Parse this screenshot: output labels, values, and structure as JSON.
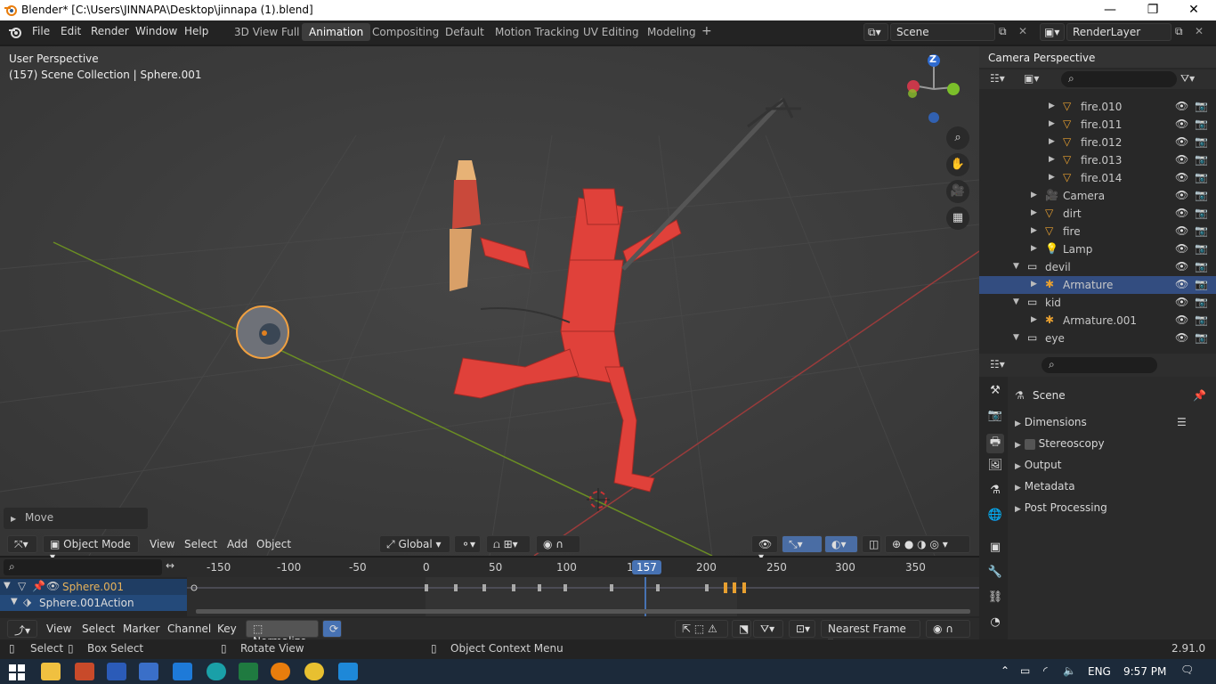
{
  "titlebar": {
    "title": "Blender* [C:\\Users\\JINNAPA\\Desktop\\jinnapa (1).blend]",
    "min": "—",
    "max": "❐",
    "close": "✕"
  },
  "menu": [
    "File",
    "Edit",
    "Render",
    "Window",
    "Help"
  ],
  "workspaces": [
    "3D View Full",
    "Animation",
    "Compositing",
    "Default",
    "Motion Tracking",
    "UV Editing",
    "Modeling"
  ],
  "workspace_add": "+",
  "scene_field": "Scene",
  "renderlayer_field": "RenderLayer",
  "viewport": {
    "perspective": "User Perspective",
    "collection": "(157) Scene Collection | Sphere.001",
    "gizmo_z": "Z",
    "operator": "Move"
  },
  "viewport_header": {
    "mode": "Object Mode",
    "menus": [
      "View",
      "Select",
      "Add",
      "Object"
    ],
    "transform": "Global"
  },
  "outliner": {
    "header": "Camera Perspective",
    "rows": [
      {
        "label": "fire.010",
        "indent": 3,
        "icon": "mesh-icon"
      },
      {
        "label": "fire.011",
        "indent": 3,
        "icon": "mesh-icon"
      },
      {
        "label": "fire.012",
        "indent": 3,
        "icon": "mesh-icon"
      },
      {
        "label": "fire.013",
        "indent": 3,
        "icon": "mesh-icon"
      },
      {
        "label": "fire.014",
        "indent": 3,
        "icon": "mesh-icon"
      },
      {
        "label": "Camera",
        "indent": 2,
        "icon": "camera-icon"
      },
      {
        "label": "dirt",
        "indent": 2,
        "icon": "mesh-icon"
      },
      {
        "label": "fire",
        "indent": 2,
        "icon": "mesh-icon"
      },
      {
        "label": "Lamp",
        "indent": 2,
        "icon": "lamp-icon"
      },
      {
        "label": "devil",
        "indent": 1,
        "icon": "collection-icon"
      },
      {
        "label": "Armature",
        "indent": 2,
        "icon": "armature-icon",
        "selected": true
      },
      {
        "label": "kid",
        "indent": 1,
        "icon": "collection-icon"
      },
      {
        "label": "Armature.001",
        "indent": 2,
        "icon": "armature-icon"
      },
      {
        "label": "eye",
        "indent": 1,
        "icon": "collection-icon"
      }
    ]
  },
  "properties": {
    "context": "Scene",
    "panels": [
      "Dimensions",
      "Stereoscopy",
      "Output",
      "Metadata",
      "Post Processing"
    ]
  },
  "timeline": {
    "ticks": [
      "-150",
      "-100",
      "-50",
      "0",
      "50",
      "100",
      "1",
      "157",
      "200",
      "250",
      "300",
      "350"
    ],
    "current_frame": "157",
    "channels": [
      "Sphere.001",
      "Sphere.001Action"
    ],
    "menus": [
      "View",
      "Select",
      "Marker",
      "Channel",
      "Key"
    ],
    "normalize": "Normalize",
    "snap": "Nearest Frame"
  },
  "statusbar": {
    "select": "Select",
    "box_select": "Box Select",
    "rotate_view": "Rotate View",
    "context_menu": "Object Context Menu",
    "version": "2.91.0"
  },
  "taskbar": {
    "lang": "ENG",
    "time": "9:57 PM"
  }
}
